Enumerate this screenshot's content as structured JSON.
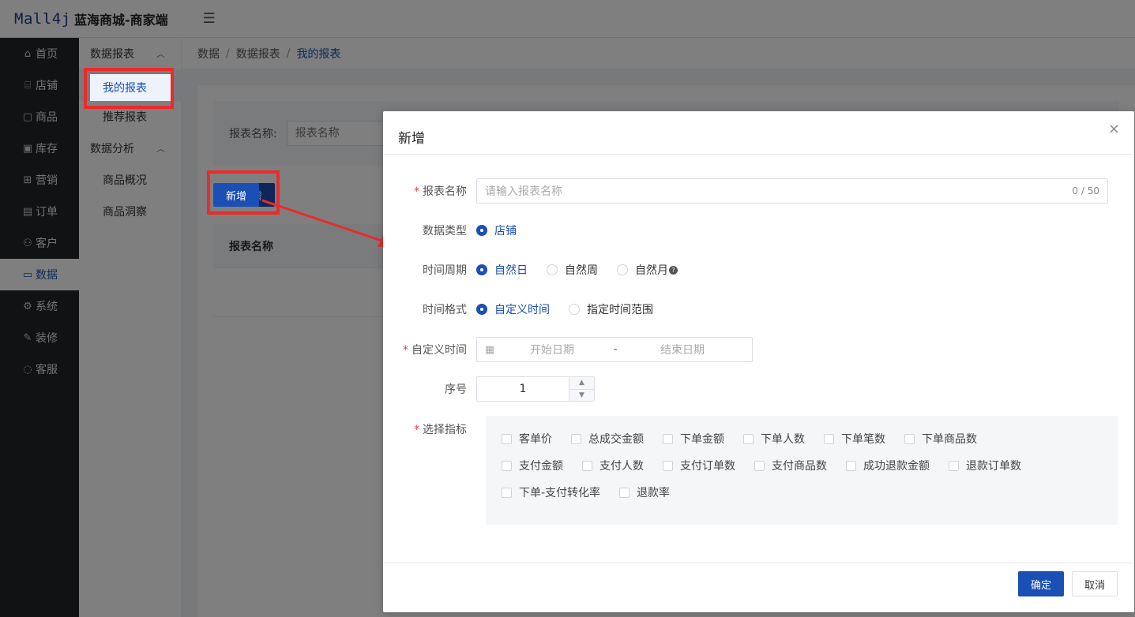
{
  "header": {
    "logo": "Mall4j",
    "brand": "蓝海商城-商家端",
    "menu_toggle_icon": "menu-fold-icon"
  },
  "sidebar": {
    "items": [
      {
        "label": "首页",
        "icon": "⌂"
      },
      {
        "label": "店铺",
        "icon": "⌸"
      },
      {
        "label": "商品",
        "icon": "▢"
      },
      {
        "label": "库存",
        "icon": "▣"
      },
      {
        "label": "营销",
        "icon": "⊞"
      },
      {
        "label": "订单",
        "icon": "▤"
      },
      {
        "label": "客户",
        "icon": "⚇"
      },
      {
        "label": "数据",
        "icon": "▭"
      },
      {
        "label": "系统",
        "icon": "⚙"
      },
      {
        "label": "装修",
        "icon": "✎"
      },
      {
        "label": "客服",
        "icon": "◌"
      }
    ]
  },
  "subsidebar": {
    "group1": "数据报表",
    "item1": "我的报表",
    "item2": "推荐报表",
    "group2": "数据分析",
    "item3": "商品概况",
    "item4": "商品洞察"
  },
  "breadcrumb": {
    "l1": "数据",
    "l2": "数据报表",
    "l3": "我的报表",
    "sep": "/"
  },
  "page": {
    "search_label": "报表名称:",
    "search_placeholder": "报表名称",
    "add_button": "新增",
    "table_header": "报表名称"
  },
  "dialog": {
    "title": "新增",
    "name_label": "报表名称",
    "name_placeholder": "请输入报表名称",
    "name_counter": "0 / 50",
    "data_type_label": "数据类型",
    "data_type_option": "店铺",
    "period_label": "时间周期",
    "period_options": [
      "自然日",
      "自然周",
      "自然月"
    ],
    "format_label": "时间格式",
    "format_options": [
      "自定义时间",
      "指定时间范围"
    ],
    "custom_time_label": "自定义时间",
    "start_placeholder": "开始日期",
    "end_placeholder": "结束日期",
    "range_sep": "-",
    "order_label": "序号",
    "order_value": "1",
    "metrics_label": "选择指标",
    "metrics_row1": [
      "客单价",
      "总成交金额",
      "下单金额",
      "下单人数",
      "下单笔数",
      "下单商品数"
    ],
    "metrics_row2": [
      "支付金额",
      "支付人数",
      "支付订单数",
      "支付商品数",
      "成功退款金额",
      "退款订单数"
    ],
    "metrics_row3": [
      "下单-支付转化率",
      "退款率"
    ],
    "ok": "确定",
    "cancel": "取消",
    "close_icon": "×"
  },
  "colors": {
    "primary": "#1a4fb5",
    "annotation": "#ec2a2a",
    "sidebar_bg": "#222426"
  }
}
